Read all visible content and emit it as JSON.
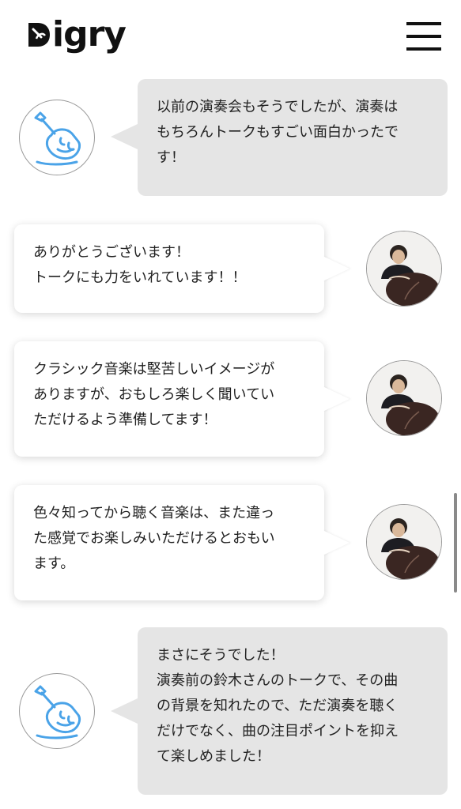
{
  "header": {
    "logo_text": "igry",
    "menu_label": "menu"
  },
  "conversation": [
    {
      "speaker": "visitor",
      "avatar_icon": "shovel-mascot-icon",
      "text": "以前の演奏会もそうでしたが、演奏は\nもちろんトークもすごい面白かったで\nす！"
    },
    {
      "speaker": "performer",
      "avatar_icon": "performer-photo",
      "text": "ありがとうございます！\nトークにも力をいれています！！"
    },
    {
      "speaker": "performer",
      "avatar_icon": "performer-photo",
      "text": "クラシック音楽は堅苦しいイメージが\nありますが、おもしろ楽しく聞いてい\nただけるよう準備してます！"
    },
    {
      "speaker": "performer",
      "avatar_icon": "performer-photo",
      "text": "色々知ってから聴く音楽は、また違っ\nた感覚でお楽しみいただけるとおもい\nます。"
    },
    {
      "speaker": "visitor",
      "avatar_icon": "shovel-mascot-icon",
      "text": "まさにそうでした！\n演奏前の鈴木さんのトークで、その曲\nの背景を知れたので、ただ演奏を聴く\nだけでなく、曲の注目ポイントを抑え\nて楽しめました！"
    }
  ],
  "colors": {
    "visitor_bubble": "#e5e5e5",
    "performer_bubble": "#ffffff",
    "mascot_blue": "#4aa3e8",
    "text": "#222222"
  }
}
